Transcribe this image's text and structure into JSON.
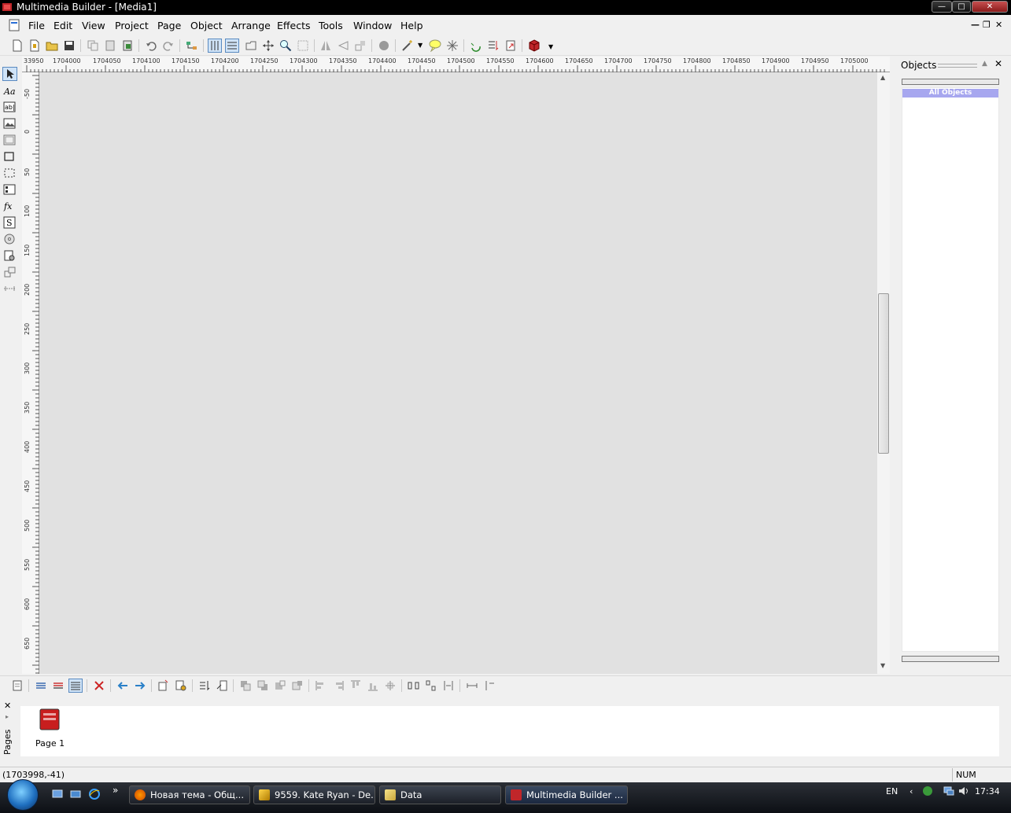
{
  "window": {
    "title": "Multimedia Builder - [Media1]"
  },
  "menu": {
    "items": [
      "File",
      "Edit",
      "View",
      "Project",
      "Page",
      "Object",
      "Arrange",
      "Effects",
      "Tools",
      "Window",
      "Help"
    ]
  },
  "ruler": {
    "h_labels": [
      "33950",
      "1704000",
      "1704050",
      "1704100",
      "1704150",
      "1704200",
      "1704250",
      "1704300",
      "1704350",
      "1704400",
      "1704450",
      "1704500",
      "1704550",
      "1704600",
      "1704650",
      "1704700",
      "1704750",
      "1704800",
      "1704850",
      "1704900",
      "1704950",
      "1705000"
    ],
    "v_labels": [
      "-50",
      "0",
      "50",
      "100",
      "150",
      "200",
      "250",
      "300",
      "350",
      "400",
      "450",
      "500",
      "550",
      "600",
      "650"
    ]
  },
  "objects_panel": {
    "title": "Objects",
    "all_objects": "All Objects"
  },
  "pages": {
    "label": "Pages",
    "items": [
      {
        "label": "Page 1"
      }
    ]
  },
  "status": {
    "coords": "(1703998,-41)",
    "num": "NUM"
  },
  "taskbar": {
    "tasks": [
      {
        "label": "Новая тема - Общ..."
      },
      {
        "label": "9559. Kate Ryan - De..."
      },
      {
        "label": "Data"
      },
      {
        "label": "Multimedia Builder ..."
      }
    ],
    "lang": "EN",
    "clock": "17:34"
  }
}
